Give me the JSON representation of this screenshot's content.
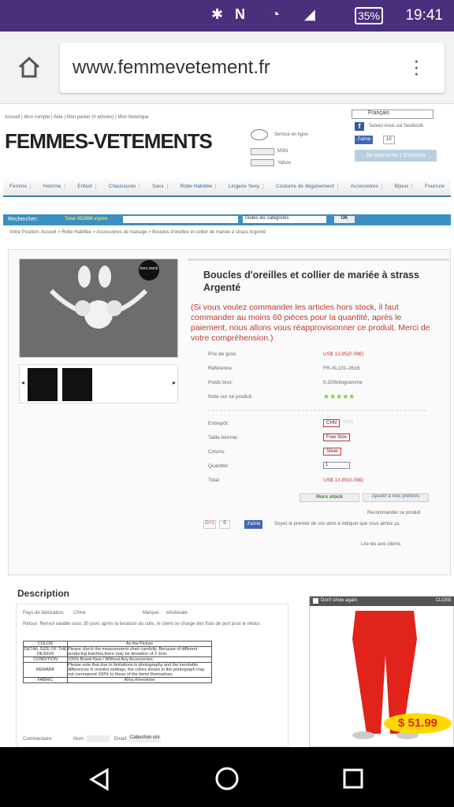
{
  "status": {
    "time": "19:41",
    "battery": "35%"
  },
  "browser": {
    "url": "www.femmevetement.fr"
  },
  "top_links": "Accueil | Mon compte | Aide | Mon panier (0 articles) | Mon historique",
  "logo": "FEMMES-VETEMENTS",
  "service": "Service en ligne",
  "msn": "MSN",
  "yahoo": "Yahoo",
  "lang": "Français",
  "facebook_follow": "Suivez-nous sur facebook",
  "fb_like": "J'aime",
  "fb_count": "10",
  "login": "Se connecter | S'inscrire",
  "nav": [
    "Femme",
    "Homme",
    "Enfant",
    "Chaussures",
    "Sacs",
    "Robe Habillée",
    "Lingerie Sexy",
    "Costume de déguisement",
    "Accessoires",
    "Bijoux",
    "Fourrure"
  ],
  "search": {
    "label": "Rechercher:",
    "total": "Total 452898 styles",
    "category": "Toutes les catégories",
    "ok": "OK"
  },
  "breadcrumb": "Votre Position: Accueil > Robe Habillée > Accessoires de mariage > Boucles d'oreilles et collier de mariée à strass Argenté",
  "product": {
    "badge": "hors stock",
    "title": "Boucles d'oreilles et collier de mariée à strass Argenté",
    "notice": "(Si vous voulez commander les articles hors stock, il faut commander au moins 60 pièces pour la quantité, après le paiement, nous allons vous réapprovisionner ce produit. Merci de votre compréhension.)",
    "price_lbl": "Prix de gros:",
    "price": "US$ 13.85(0.09€)",
    "ref_lbl": "Référence:",
    "ref": "FR-XL101-2616",
    "weight_lbl": "Poids brut:",
    "weight": "0.200kilogramme",
    "rating_lbl": "Note sur ce produit:",
    "stars": "★★★★★",
    "entrepot_lbl": "Entrepôt:",
    "entrepot_opt1": "CHN",
    "entrepot_opt2": "USA",
    "size_lbl": "Taille femme:",
    "size": "Free Size",
    "color_lbl": "Coloris:",
    "color": "Silver",
    "qty_lbl": "Quantité:",
    "qty": "1",
    "total_lbl": "Total:",
    "total": "US$ 13.85(0.09€)",
    "hors_stock": "Hors stock",
    "wishlist": "Ajouter à mes préférés",
    "recommend": "Recommander ce produit",
    "gplus": "G+1",
    "gcount": "0",
    "fb_text": "Soyez le premier de vos amis à indiquer que vous aimez ça.",
    "reviews": "Lire les avis clients"
  },
  "description": {
    "title": "Description",
    "fab_lbl": "Pays de fabrication:",
    "fab": "Chine",
    "brand_lbl": "Marque:",
    "brand": "wholesale",
    "return": "Retour: Renvoi valable sous 30 jours après la livraison du colis, le client se charge des frais de port pour le retour.",
    "rows": [
      [
        "COLOR",
        "As the Picture"
      ],
      [
        "DETAIL SIZE OF THE DESIGN",
        "Please check the measurement chart carefully. Because of different producing batches,there may be deviation of 2-3cm."
      ],
      [
        "CONDITION",
        "100% Brand New / Without Any Accessories."
      ],
      [
        "REMARK",
        "Please note that due to limitations in photography and the inevitable differences in monitor settings, the colors shown in the photograph may not correspond 100% to those of the items themselves."
      ],
      [
        "FABRIC",
        "Alloy,rhinestone"
      ]
    ],
    "footer1": "Commentaire:",
    "footer2": "Nom:",
    "footer3": "Email:",
    "footer_btn": "Cabochon uni"
  },
  "ad": {
    "dont_show": "Don't show again",
    "close": "CLOSE",
    "price": "$ 51.99"
  }
}
